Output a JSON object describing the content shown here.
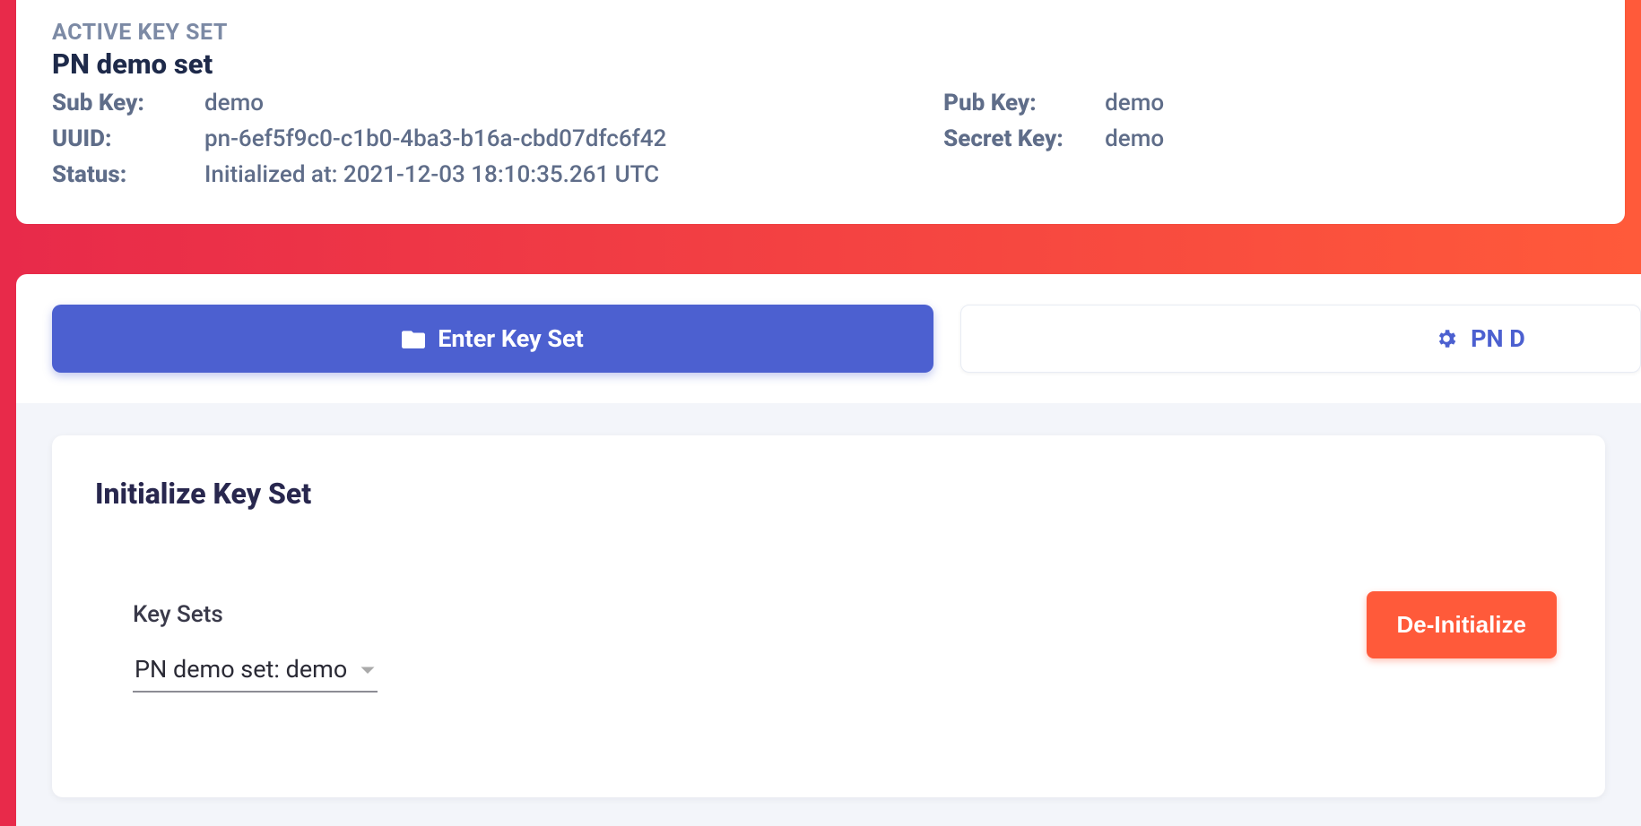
{
  "active_keyset": {
    "header_label": "ACTIVE KEY SET",
    "name": "PN demo set",
    "sub_key_label": "Sub Key:",
    "sub_key": "demo",
    "pub_key_label": "Pub Key:",
    "pub_key": "demo",
    "uuid_label": "UUID:",
    "uuid": "pn-6ef5f9c0-c1b0-4ba3-b16a-cbd07dfc6f42",
    "secret_key_label": "Secret Key:",
    "secret_key": "demo",
    "status_label": "Status:",
    "status": "Initialized at: 2021-12-03 18:10:35.261 UTC"
  },
  "tabs": {
    "enter_label": "Enter Key Set",
    "manage_label": "PN D"
  },
  "panel": {
    "title": "Initialize Key Set",
    "keysets_label": "Key Sets",
    "selected_keyset": "PN demo set: demo",
    "deinit_label": "De-Initialize"
  }
}
